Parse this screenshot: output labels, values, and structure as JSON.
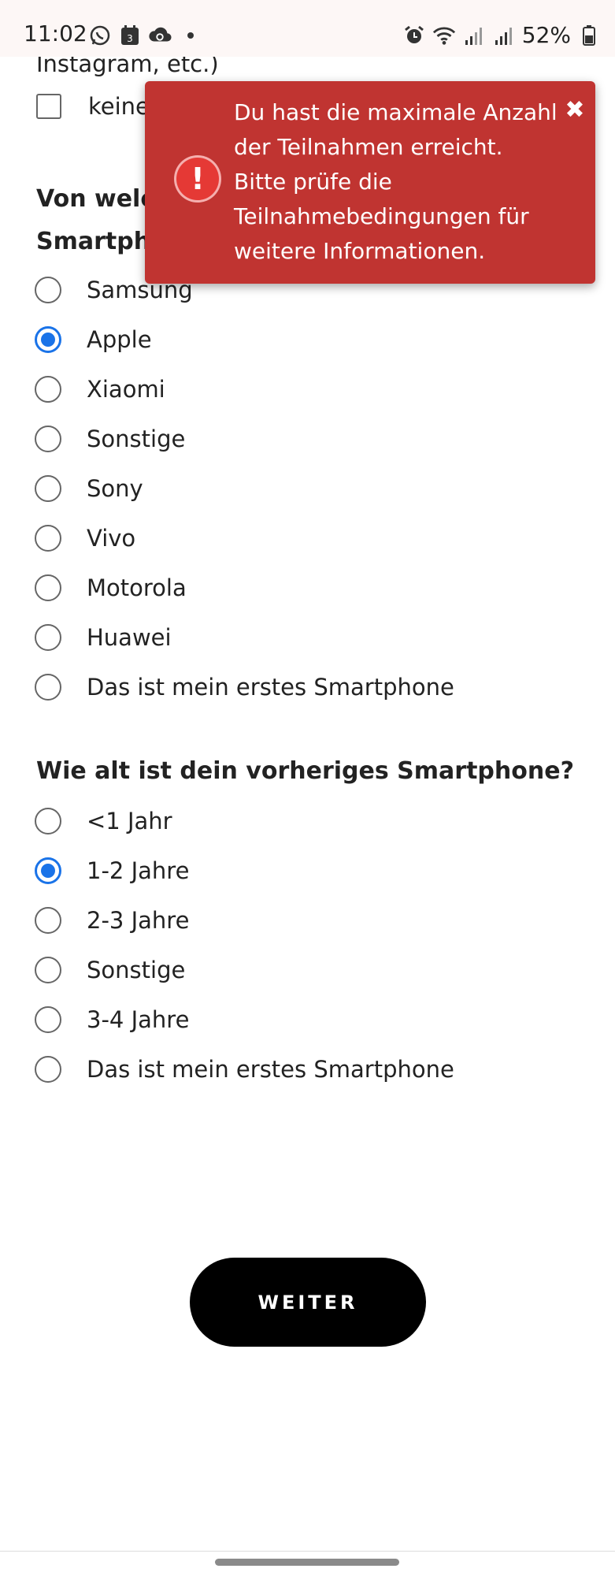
{
  "status_bar": {
    "time": "11:02",
    "calendar_day": "3",
    "battery": "52%",
    "left_icons": [
      "whatsapp-icon",
      "calendar-icon",
      "cloud-sync-icon"
    ],
    "right_icons": [
      "alarm-icon",
      "wifi-icon",
      "signal-icon",
      "signal-icon",
      "battery-icon"
    ]
  },
  "form": {
    "partial_text": "Instagram, etc.)",
    "none_option": "keine",
    "question1": "Von welcher Marke war dein vorheriges\nSmartphone?",
    "brand_options": [
      {
        "label": "Samsung",
        "selected": false
      },
      {
        "label": "Apple",
        "selected": true
      },
      {
        "label": "Xiaomi",
        "selected": false
      },
      {
        "label": "Sonstige",
        "selected": false
      },
      {
        "label": "Sony",
        "selected": false
      },
      {
        "label": "Vivo",
        "selected": false
      },
      {
        "label": "Motorola",
        "selected": false
      },
      {
        "label": "Huawei",
        "selected": false
      },
      {
        "label": "Das ist mein erstes Smartphone",
        "selected": false
      }
    ],
    "question2": "Wie alt ist dein vorheriges Smartphone?",
    "age_options": [
      {
        "label": "<1 Jahr",
        "selected": false
      },
      {
        "label": "1-2 Jahre",
        "selected": true
      },
      {
        "label": "2-3 Jahre",
        "selected": false
      },
      {
        "label": "Sonstige",
        "selected": false
      },
      {
        "label": "3-4 Jahre",
        "selected": false
      },
      {
        "label": "Das ist mein erstes Smartphone",
        "selected": false
      }
    ],
    "submit_label": "WEITER"
  },
  "toast": {
    "message": "Du hast die maximale Anzahl der Teilnahmen erreicht.\nBitte prüfe die Teilnahmebedingungen für weitere Informationen.",
    "icon_glyph": "!",
    "close_glyph": "✖"
  },
  "colors": {
    "accent": "#1a73e8",
    "toast_bg": "#c03431",
    "button_bg": "#000000"
  }
}
